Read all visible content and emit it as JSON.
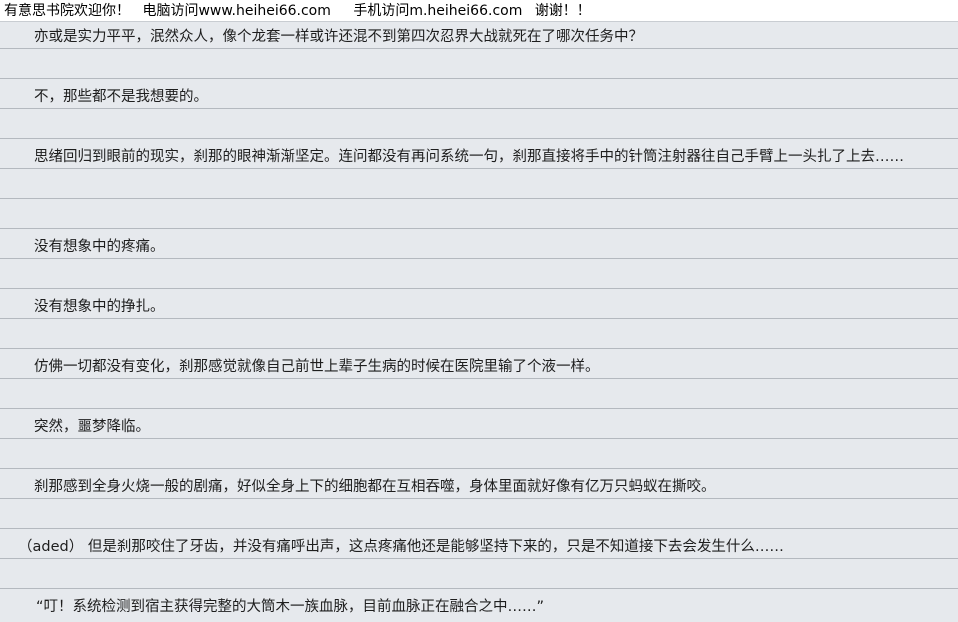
{
  "header": {
    "welcome": "有意思书院欢迎你！",
    "pc_visit": "电脑访问www.heihei66.com",
    "mobile_visit": "手机访问m.heihei66.com",
    "thanks": "谢谢！！"
  },
  "paragraphs": [
    "亦或是实力平平，泯然众人，像个龙套一样或许还混不到第四次忍界大战就死在了哪次任务中？",
    "不，那些都不是我想要的。",
    "思绪回归到眼前的现实，刹那的眼神渐渐坚定。连问都没有再问系统一句，刹那直接将手中的针筒注射器往自己手臂上一头扎了上去……",
    "没有想象中的疼痛。",
    "没有想象中的挣扎。",
    "仿佛一切都没有变化，刹那感觉就像自己前世上辈子生病的时候在医院里输了个液一样。",
    "突然，噩梦降临。",
    "刹那感到全身火烧一般的剧痛，好似全身上下的细胞都在互相吞噬，身体里面就好像有亿万只蚂蚁在撕咬。",
    "（aded） 但是刹那咬住了牙齿，并没有痛呼出声，这点疼痛他还是能够坚持下来的，只是不知道接下去会发生什么……",
    "“叮！系统检测到宿主获得完整的大筒木一族血脉，目前血脉正在融合之中……”"
  ]
}
